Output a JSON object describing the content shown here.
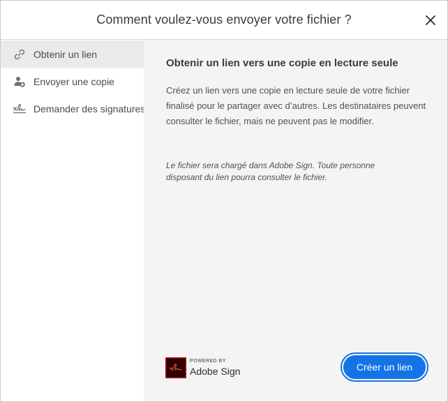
{
  "dialog": {
    "title": "Comment voulez-vous envoyer votre fichier ?",
    "close_icon": "close-icon"
  },
  "sidebar": {
    "items": [
      {
        "label": "Obtenir un lien",
        "icon": "link-icon",
        "active": true
      },
      {
        "label": "Envoyer une copie",
        "icon": "add-person-icon",
        "active": false
      },
      {
        "label": "Demander des signatures",
        "icon": "signature-icon",
        "active": false
      }
    ]
  },
  "content": {
    "title": "Obtenir un lien vers une copie en lecture seule",
    "description": "Créez un lien vers une copie en lecture seule de votre fichier finalisé pour le partager avec d’autres. Les destinataires peuvent consulter le fichier, mais ne peuvent pas le modifier.",
    "note": "Le fichier sera chargé dans Adobe Sign. Toute personne disposant du lien pourra consulter le fichier."
  },
  "branding": {
    "powered_by": "POWERED BY",
    "name": "Adobe Sign",
    "logo_icon": "adobe-sign-logo",
    "logo_color": "#b30b00"
  },
  "actions": {
    "primary_label": "Créer un lien",
    "primary_color": "#1473e6"
  }
}
